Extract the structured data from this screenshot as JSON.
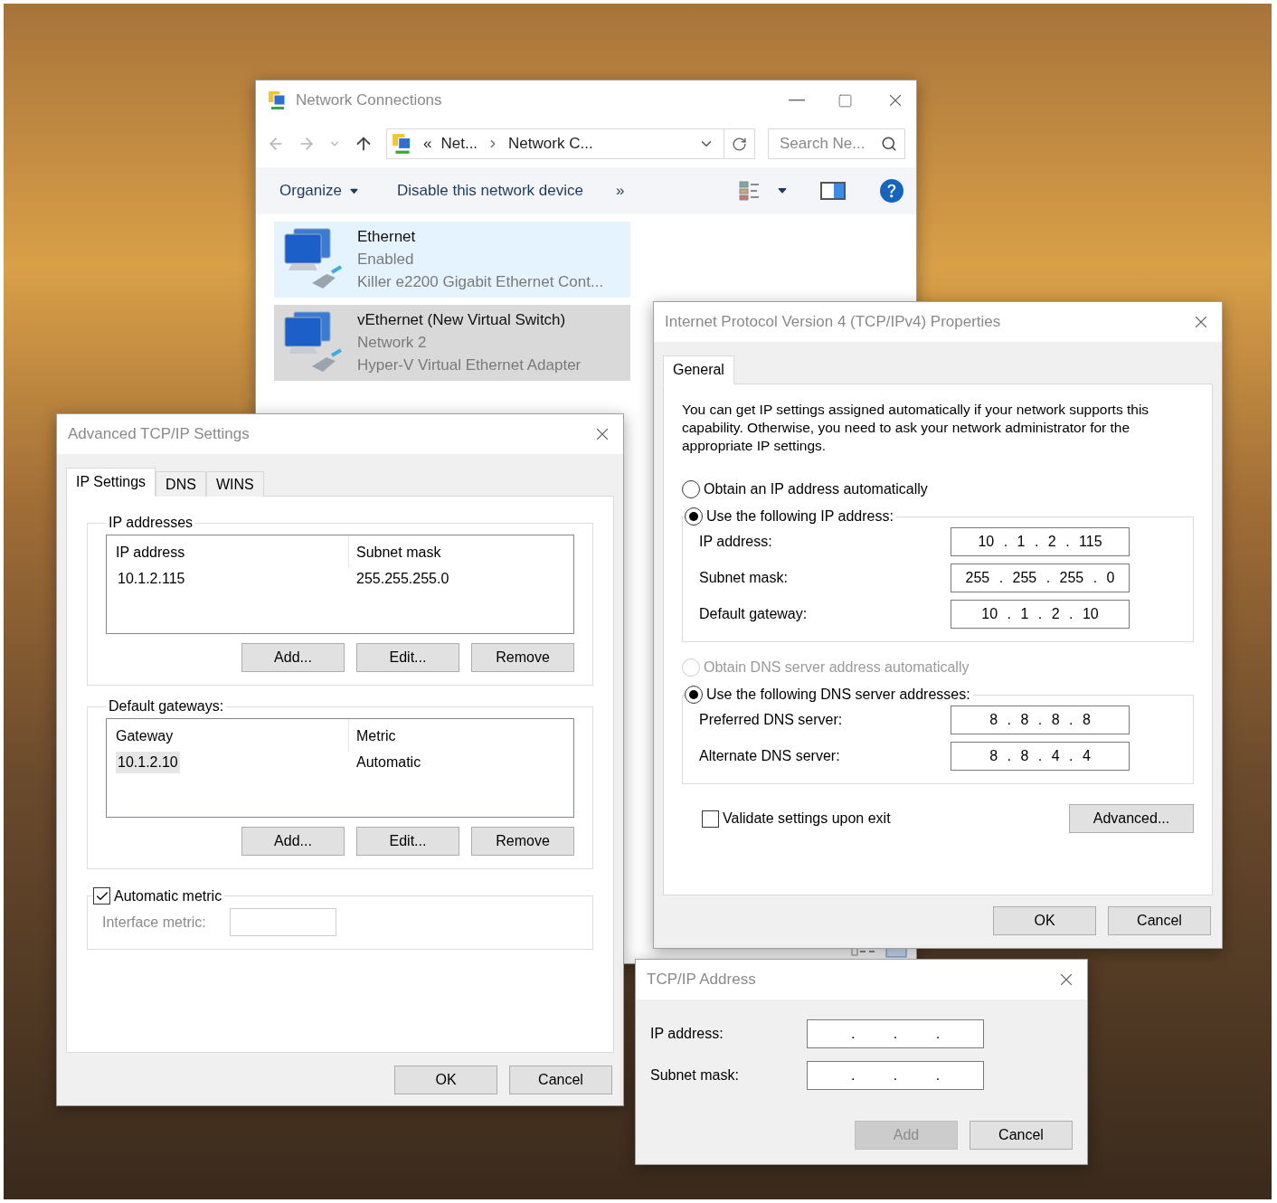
{
  "network_connections": {
    "title": "Network Connections",
    "address": {
      "overflow": "«",
      "breadcrumbs": [
        "Net...",
        "Network C..."
      ]
    },
    "search": {
      "placeholder": "Search Ne..."
    },
    "commands": {
      "organize": "Organize",
      "disable": "Disable this network device",
      "more": "»"
    },
    "adapters": [
      {
        "name": "Ethernet",
        "status": "Enabled",
        "device": "Killer e2200 Gigabit Ethernet Cont...",
        "selected": false,
        "hovered": true
      },
      {
        "name": "vEthernet (New Virtual Switch)",
        "status": "Network  2",
        "device": "Hyper-V Virtual Ethernet Adapter",
        "selected": true,
        "hovered": false
      }
    ]
  },
  "advanced_tcpip": {
    "title": "Advanced TCP/IP Settings",
    "tabs": [
      {
        "label": "IP Settings",
        "selected": true
      },
      {
        "label": "DNS",
        "selected": false
      },
      {
        "label": "WINS",
        "selected": false
      }
    ],
    "ip_addresses": {
      "legend": "IP addresses",
      "columns": [
        "IP address",
        "Subnet mask"
      ],
      "rows": [
        {
          "cells": [
            "10.1.2.115",
            "255.255.255.0"
          ],
          "selected": false
        }
      ],
      "buttons": [
        "Add...",
        "Edit...",
        "Remove"
      ]
    },
    "default_gateways": {
      "legend": "Default gateways:",
      "columns": [
        "Gateway",
        "Metric"
      ],
      "rows": [
        {
          "cells": [
            "10.1.2.10",
            "Automatic"
          ],
          "selected": true
        }
      ],
      "buttons": [
        "Add...",
        "Edit...",
        "Remove"
      ]
    },
    "automatic_metric": {
      "label": "Automatic metric",
      "checked": true
    },
    "interface_metric": {
      "label": "Interface metric:",
      "disabled": true
    },
    "buttons": [
      "OK",
      "Cancel"
    ]
  },
  "ipv4_properties": {
    "title": "Internet Protocol Version 4 (TCP/IPv4) Properties",
    "tabs": [
      {
        "label": "General",
        "selected": true
      }
    ],
    "intro": "You can get IP settings assigned automatically if your network supports this capability. Otherwise, you need to ask your network administrator for the appropriate IP settings.",
    "ip_options": [
      {
        "label": "Obtain an IP address automatically",
        "selected": false,
        "disabled": false
      },
      {
        "label": "Use the following IP address:",
        "selected": true,
        "disabled": false
      }
    ],
    "ip_fields": [
      {
        "label": "IP address:",
        "value": "10 . 1 . 2 . 115"
      },
      {
        "label": "Subnet mask:",
        "value": "255 . 255 . 255 . 0"
      },
      {
        "label": "Default gateway:",
        "value": "10 . 1 . 2 . 10"
      }
    ],
    "dns_options": [
      {
        "label": "Obtain DNS server address automatically",
        "selected": false,
        "disabled": true
      },
      {
        "label": "Use the following DNS server addresses:",
        "selected": true,
        "disabled": false
      }
    ],
    "dns_fields": [
      {
        "label": "Preferred DNS server:",
        "value": "8 . 8 . 8 . 8"
      },
      {
        "label": "Alternate DNS server:",
        "value": "8 . 8 . 4 . 4"
      }
    ],
    "validate": {
      "label": "Validate settings upon exit",
      "checked": false
    },
    "advanced_button": "Advanced...",
    "buttons": [
      "OK",
      "Cancel"
    ]
  },
  "tcpip_address": {
    "title": "TCP/IP Address",
    "fields": [
      {
        "label": "IP address:",
        "value": ". . ."
      },
      {
        "label": "Subnet mask:",
        "value": ". . ."
      }
    ],
    "buttons": [
      {
        "label": "Add",
        "disabled": true
      },
      {
        "label": "Cancel",
        "disabled": false
      }
    ]
  }
}
